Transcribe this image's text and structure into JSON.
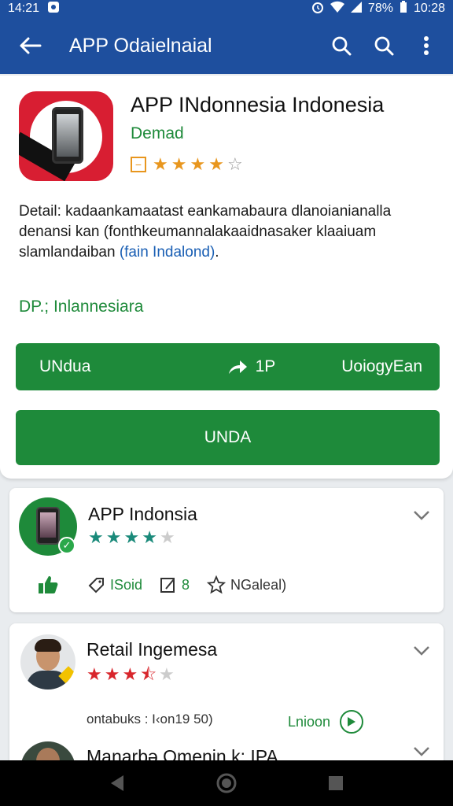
{
  "status_bar": {
    "time_left": "14:21",
    "battery": "78%",
    "time_right": "10:28"
  },
  "app_bar": {
    "title": "APP Odaielnaial"
  },
  "app_detail": {
    "name": "APP INdonnesia Indonesia",
    "developer": "Demad",
    "rating_box": "−",
    "rating": 4,
    "rating_max": 5,
    "description_main": "Detail: kadaankamaatast eankamabaura dlanoianianalla denansi kan (fonthkeumannalakaaidnasaker klaaiuam slamlandaiban ",
    "description_link": "(fain Indalond)",
    "description_end": ".",
    "category": "DP.; Inlannesiara"
  },
  "buttons": {
    "row_left": "UNdua",
    "row_mid": "1P",
    "row_right": "UoiogуEan",
    "big": "UNDA"
  },
  "card1": {
    "title": "APP Indonsia",
    "rating": 4,
    "rating_max": 5,
    "action_tag": "ISoid",
    "action_count": "8",
    "action_star": "NGaleal)"
  },
  "card2": {
    "title": "Retail Ingemesa",
    "rating": 3.5,
    "rating_max": 5,
    "info": "ontabuks : I‹on19 50)",
    "link": "Lnioon",
    "next_title": "Manarbə Omenin k: IPA"
  },
  "colors": {
    "primary_blue": "#1e4f9e",
    "green": "#1e8a3a",
    "star_orange": "#e8961e",
    "star_teal": "#1a8a7a",
    "star_red": "#d8262c"
  }
}
